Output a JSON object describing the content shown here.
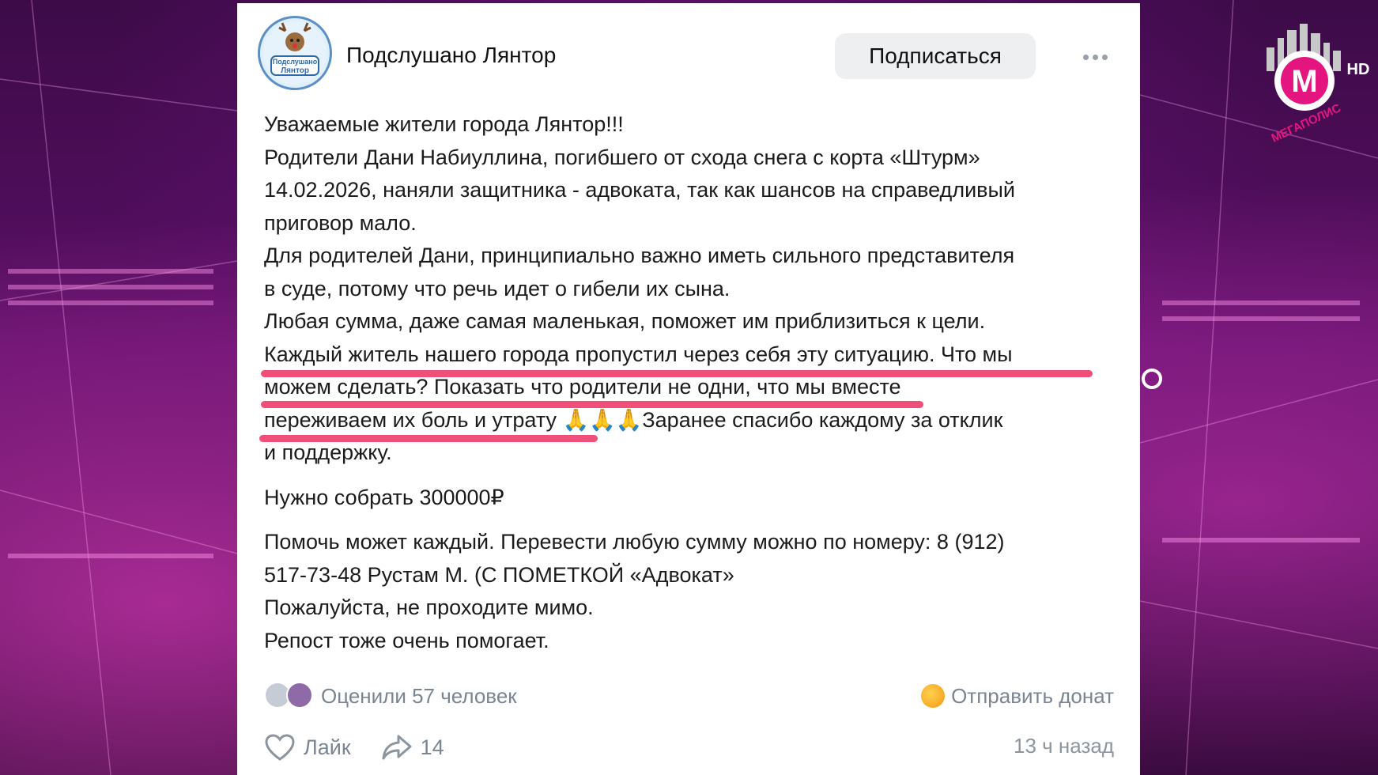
{
  "group": {
    "name": "Подслушано Лянтор",
    "avatar_text": "Подслушано\nЛянтор",
    "subscribe_label": "Подписаться"
  },
  "post": {
    "lines": [
      "Уважаемые жители города Лянтор!!!",
      "Родители Дани Набиуллина, погибшего от схода снега с корта «Штурм»",
      "14.02.2026, наняли защитника - адвоката, так как шансов на справедливый",
      "приговор мало.",
      "Для родителей Дани, принципиально важно иметь сильного представителя",
      "в суде, потому что речь идет о гибели их сына.",
      "Любая сумма, даже самая маленькая, поможет им приблизиться к цели.",
      "Каждый житель нашего города пропустил через себя эту ситуацию. Что мы",
      "можем сделать? Показать что родители не одни, что мы вместе",
      "переживаем их боль и утрату 🙏🙏🙏Заранее спасибо каждому за отклик",
      "и поддержку."
    ],
    "goal": "Нужно собрать 300000₽",
    "help_lines": [
      "Помочь может каждый. Перевести любую сумму можно по номеру: 8 (912)",
      "517-73-48 Рустам М. (С ПОМЕТКОЙ «Адвокат»",
      "Пожалуйста, не проходите мимо.",
      "Репост тоже очень помогает."
    ]
  },
  "reactions": {
    "text": "Оценили 57 человек"
  },
  "donate": {
    "label": "Отправить донат"
  },
  "actions": {
    "like_label": "Лайк",
    "share_count": "14",
    "time": "13 ч назад"
  },
  "channel_logo": {
    "letter": "M",
    "name": "МЕГАПОЛИС",
    "badge": "HD"
  },
  "colors": {
    "underline": "#ef4f78",
    "accent_bg": "#5a0f66"
  }
}
